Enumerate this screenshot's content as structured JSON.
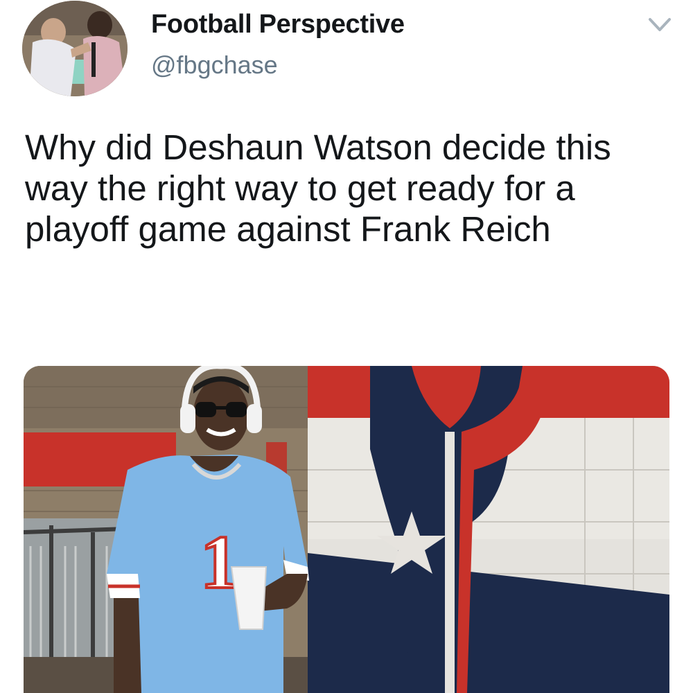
{
  "tweet": {
    "display_name": "Football Perspective",
    "handle": "@fbgchase",
    "text": "Why did Deshaun Watson decide this way the right way to get ready for a playoff game against Frank Reich"
  },
  "avatar": {
    "icon": "profile-photo"
  },
  "menu": {
    "icon": "chevron-down-icon"
  },
  "media": {
    "jersey_number": "1",
    "colors": {
      "navy": "#1c2a4a",
      "red": "#c8322a",
      "jersey": "#7fb6e6",
      "wall": "#e9e7e2"
    }
  }
}
